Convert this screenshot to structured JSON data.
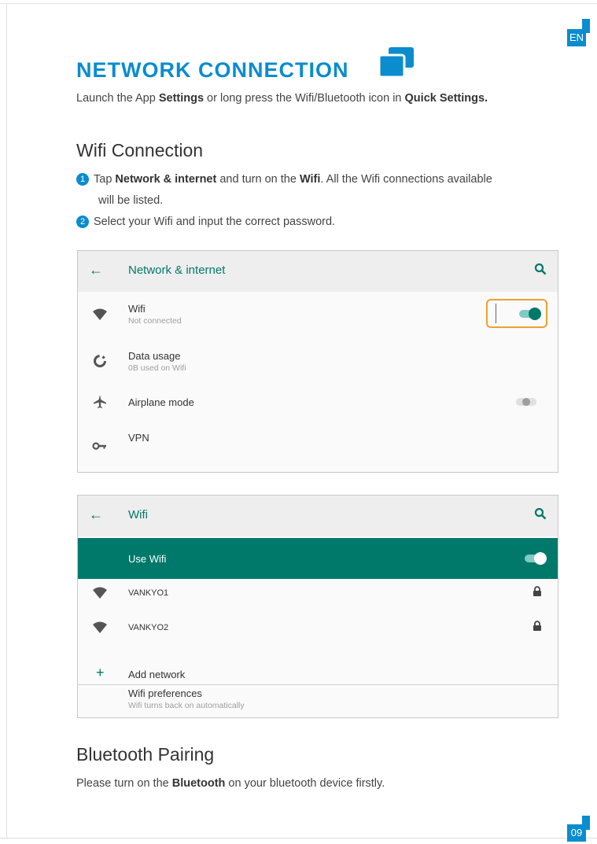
{
  "lang_badge": "EN",
  "page_number": "09",
  "title": "NETWORK CONNECTION",
  "intro": {
    "pre": "Launch the App ",
    "settings": "Settings",
    "mid": " or long press the Wifi/Bluetooth icon in ",
    "quick": "Quick Settings."
  },
  "wifi_section": {
    "heading": "Wifi Connection",
    "step1": {
      "num": "1",
      "pre": "Tap ",
      "network": "Network & internet",
      "mid": " and turn on the ",
      "wifi": "Wifi",
      "post": ". All the Wifi connections available",
      "line2": "will be listed."
    },
    "step2": {
      "num": "2",
      "text": "Select your Wifi and input the correct password."
    }
  },
  "screen1": {
    "title": "Network & internet",
    "items": [
      {
        "label": "Wifi",
        "sub": "Not connected",
        "icon": "wifi-icon",
        "toggle": "on"
      },
      {
        "label": "Data usage",
        "sub": "0B used on Wifi",
        "icon": "data-usage-icon"
      },
      {
        "label": "Airplane mode",
        "icon": "airplane-icon",
        "toggle": "off"
      },
      {
        "label": "VPN",
        "icon": "key-icon"
      }
    ]
  },
  "screen2": {
    "title": "Wifi",
    "use_wifi": "Use Wifi",
    "networks": [
      {
        "name": "VANKYO1",
        "icon": "wifi-icon",
        "locked": true
      },
      {
        "name": "VANKYO2",
        "icon": "wifi-icon",
        "locked": true
      }
    ],
    "add_network": "Add network",
    "preferences": {
      "label": "Wifi preferences",
      "sub": "Wifi turns back on automatically"
    }
  },
  "bluetooth_section": {
    "heading": "Bluetooth Pairing",
    "pre": "Please turn on the ",
    "bluetooth": "Bluetooth",
    "post": " on your bluetooth device firstly."
  },
  "colors": {
    "accent_blue": "#0a8ccf",
    "teal": "#00796b",
    "highlight": "#f0a030"
  }
}
